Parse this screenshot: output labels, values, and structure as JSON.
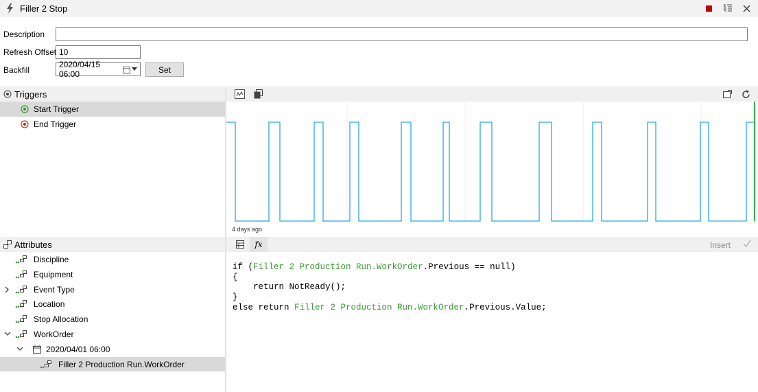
{
  "window": {
    "title": "Filler 2 Stop"
  },
  "titlebar_icons": {
    "stop": "stop-square-icon",
    "tree": "tree-list-icon",
    "close": "close-icon"
  },
  "form": {
    "description_label": "Description",
    "description_value": "",
    "refresh_offset_label": "Refresh Offset",
    "refresh_offset_value": "10",
    "backfill_label": "Backfill",
    "backfill_value": "2020/04/15 06:00",
    "set_label": "Set"
  },
  "triggers": {
    "header": "Triggers",
    "items": [
      {
        "label": "Start Trigger",
        "selected": true,
        "color": "#3c9a36"
      },
      {
        "label": "End Trigger",
        "selected": false,
        "color": "#c0392b"
      }
    ]
  },
  "chart_panel": {
    "time_label": "4 days ago",
    "line_color": "#29a8e0",
    "chart_data": {
      "type": "line",
      "series": [
        {
          "values": [
            1,
            0,
            1,
            0,
            1,
            0,
            1,
            0,
            1,
            0,
            1,
            0,
            1,
            0,
            1,
            0,
            1,
            0,
            1,
            0,
            1,
            0,
            1,
            0,
            1
          ]
        }
      ]
    }
  },
  "attributes": {
    "header": "Attributes",
    "items": [
      {
        "label": "Discipline",
        "level": 1
      },
      {
        "label": "Equipment",
        "level": 1
      },
      {
        "label": "Event Type",
        "level": 1,
        "expander": "right"
      },
      {
        "label": "Location",
        "level": 1
      },
      {
        "label": "Stop Allocation",
        "level": 1
      },
      {
        "label": "WorkOrder",
        "level": 1,
        "expander": "down"
      },
      {
        "label": "2020/04/01 06:00",
        "level": 2,
        "expander": "down"
      },
      {
        "label": "Filler 2 Production Run.WorkOrder",
        "level": 3,
        "selected": true
      }
    ]
  },
  "editor": {
    "insert_label": "Insert",
    "fx_label": "fx",
    "code": {
      "l1_a": "if (",
      "l1_b": "Filler 2 Production Run.WorkOrder",
      "l1_c": ".Previous == null)",
      "l2": "{",
      "l3": "    return NotReady();",
      "l4": "}",
      "l5_a": "else return ",
      "l5_b": "Filler 2 Production Run.WorkOrder",
      "l5_c": ".Previous.Value;"
    }
  }
}
